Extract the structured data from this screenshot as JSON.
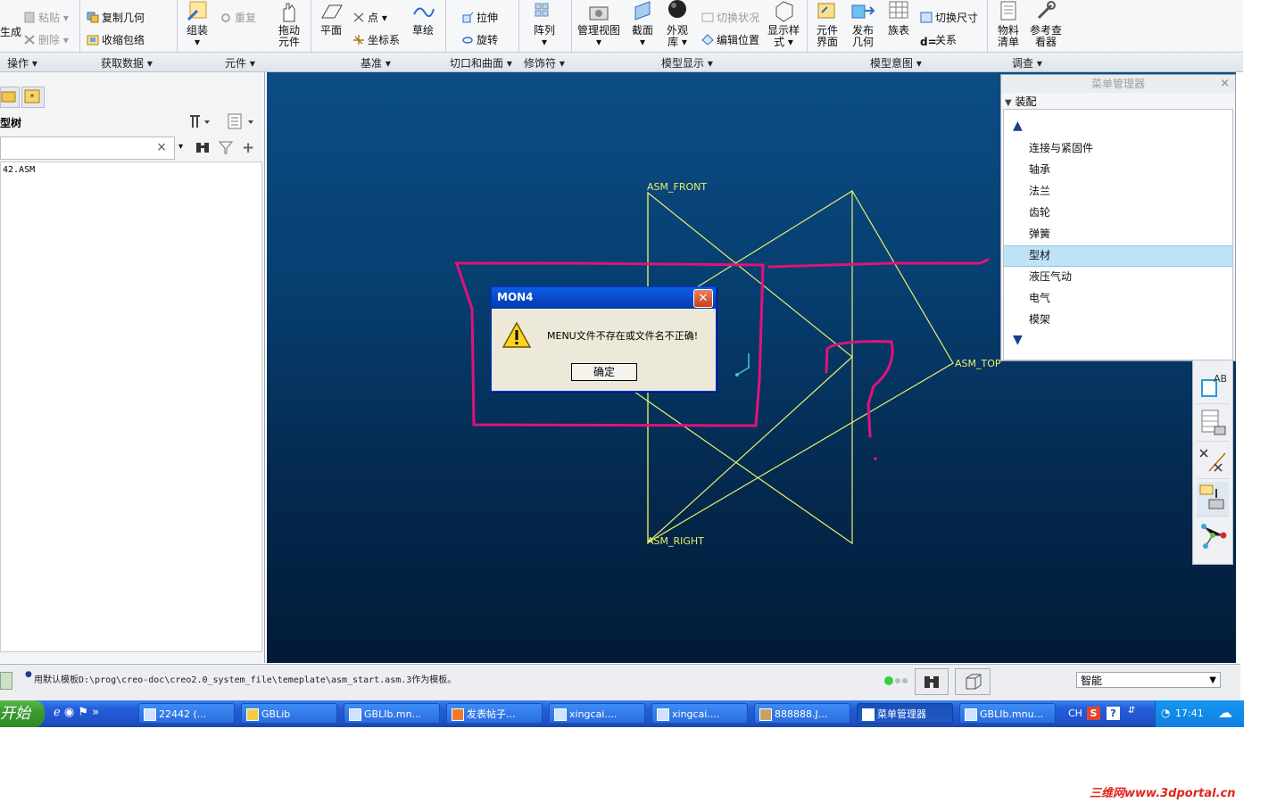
{
  "ribbon": {
    "buttons": {
      "generate_partial": "生成",
      "paste": "粘贴",
      "delete": "删除",
      "copy_geometry": "复制几何",
      "shrinkwrap": "收缩包络",
      "assemble": "组装",
      "redo": "重复",
      "drag_components": [
        "拖动",
        "元件"
      ],
      "plane": "平面",
      "point": "点",
      "coordinate_system": "坐标系",
      "sketch": "草绘",
      "extrude": "拉伸",
      "revolve": "旋转",
      "pattern": "阵列",
      "manage_views": "管理视图",
      "section": "截面",
      "appearance_gallery": [
        "外观",
        "库"
      ],
      "switch_status": "切换状况",
      "edit_position": "编辑位置",
      "display_style": [
        "显示样",
        "式"
      ],
      "component_interface": [
        "元件",
        "界面"
      ],
      "publish_geometry": [
        "发布",
        "几何"
      ],
      "family_table": "族表",
      "switch_dimensions": "切换尺寸",
      "relations": "关系",
      "bill_of_materials": [
        "物料",
        "清单"
      ],
      "reference_viewer": [
        "参考查",
        "看器"
      ]
    },
    "groups": [
      "操作",
      "获取数据",
      "元件",
      "基准",
      "切口和曲面",
      "修饰符",
      "模型显示",
      "模型意图",
      "调查"
    ]
  },
  "left_panel": {
    "tree_title": "型树",
    "tree_item": "42.ASM"
  },
  "viewport": {
    "datum_labels": [
      "ASM_FRONT",
      "ASM_TOP",
      "ASM_RIGHT"
    ]
  },
  "dialog": {
    "title": "MON4",
    "message": "MENU文件不存在或文件名不正确!",
    "ok": "确定"
  },
  "menu_manager": {
    "title": "菜单管理器",
    "section": "装配",
    "items": [
      "连接与紧固件",
      "轴承",
      "法兰",
      "齿轮",
      "弹簧",
      "型材",
      "液压气动",
      "电气",
      "模架"
    ],
    "selected": "型材"
  },
  "status_bar": {
    "message": "用默认模板D:\\prog\\creo-doc\\creo2.0_system_file\\temeplate\\asm_start.asm.3作为模板。",
    "filter": "智能"
  },
  "taskbar": {
    "start": "开始",
    "tasks": [
      "22442 (...",
      "GBLib",
      "GBLIb.mn...",
      "发表帖子...",
      "xingcai....",
      "xingcai....",
      "888888.J...",
      "菜单管理器",
      "GBLIb.mnu..."
    ],
    "lang": "CH",
    "clock": "17:41"
  },
  "watermark": "三维网www.3dportal.cn",
  "colors": {
    "viewport_top": "#0b4d84",
    "viewport_bottom": "#021b36",
    "datum": "#e8f06a",
    "annotation": "#e0137a",
    "selection": "#bfe3f6"
  }
}
